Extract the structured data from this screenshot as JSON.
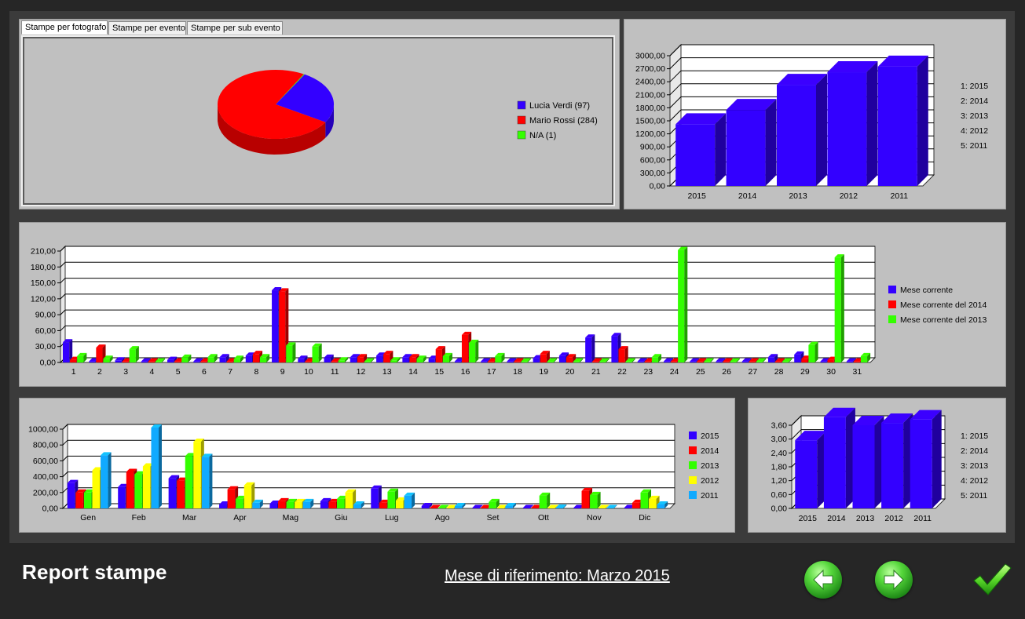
{
  "tabs": [
    "Stampe per fotografo",
    "Stampe per evento",
    "Stampe per sub evento"
  ],
  "footer": {
    "title": "Report stampe",
    "reference": "Mese di riferimento: Marzo 2015"
  },
  "icons": {
    "back": "arrow-left-icon",
    "forward": "arrow-right-icon",
    "confirm": "checkmark-icon"
  },
  "colors": {
    "2015": "#3300ff",
    "2014": "#ff0000",
    "2013": "#33ff00",
    "2012": "#ffff00",
    "2011": "#11aaff",
    "panel": "#c0c0c0"
  },
  "chart_data": [
    {
      "type": "pie",
      "slices": [
        {
          "label": "Lucia Verdi (97)",
          "value": 97,
          "color": "#3300ff"
        },
        {
          "label": "Mario Rossi (284)",
          "value": 284,
          "color": "#ff0000"
        },
        {
          "label": "N/A (1)",
          "value": 1,
          "color": "#33ff00"
        }
      ]
    },
    {
      "type": "bar",
      "categories": [
        "2015",
        "2014",
        "2013",
        "2012",
        "2011"
      ],
      "values": [
        1420,
        1750,
        2330,
        2620,
        2750
      ],
      "ylim": [
        0,
        3000
      ],
      "yticks": [
        "0,00",
        "300,00",
        "600,00",
        "900,00",
        "1200,00",
        "1500,00",
        "1800,00",
        "2100,00",
        "2400,00",
        "2700,00",
        "3000,00"
      ],
      "legend": [
        "1: 2015",
        "2: 2014",
        "3: 2013",
        "4: 2012",
        "5: 2011"
      ]
    },
    {
      "type": "bar",
      "categories": [
        "1",
        "2",
        "3",
        "4",
        "5",
        "6",
        "7",
        "8",
        "9",
        "10",
        "11",
        "12",
        "13",
        "14",
        "15",
        "16",
        "17",
        "18",
        "19",
        "20",
        "21",
        "22",
        "23",
        "24",
        "25",
        "26",
        "27",
        "28",
        "29",
        "30",
        "31"
      ],
      "ylim": [
        0,
        210
      ],
      "yticks": [
        "0,00",
        "30,00",
        "60,00",
        "90,00",
        "120,00",
        "150,00",
        "180,00",
        "210,00"
      ],
      "series": [
        {
          "name": "Mese corrente",
          "color": "#3300ff",
          "values": [
            38,
            2,
            4,
            2,
            5,
            2,
            10,
            13,
            136,
            7,
            9,
            10,
            13,
            10,
            7,
            2,
            2,
            2,
            8,
            13,
            47,
            50,
            2,
            2,
            2,
            2,
            2,
            10,
            15,
            2,
            2
          ]
        },
        {
          "name": "Mese corrente del 2014",
          "color": "#ff0000",
          "values": [
            5,
            28,
            2,
            2,
            2,
            2,
            2,
            16,
            134,
            2,
            2,
            10,
            16,
            10,
            25,
            52,
            2,
            2,
            16,
            10,
            2,
            25,
            2,
            2,
            2,
            2,
            2,
            2,
            7,
            5,
            2
          ]
        },
        {
          "name": "Mese corrente del 2013",
          "color": "#33ff00",
          "values": [
            12,
            7,
            25,
            2,
            9,
            10,
            7,
            10,
            32,
            30,
            4,
            2,
            4,
            7,
            12,
            37,
            12,
            2,
            2,
            2,
            2,
            2,
            10,
            212,
            2,
            2,
            2,
            2,
            33,
            198,
            12
          ]
        }
      ]
    },
    {
      "type": "bar",
      "categories": [
        "Gen",
        "Feb",
        "Mar",
        "Apr",
        "Mag",
        "Giu",
        "Lug",
        "Ago",
        "Set",
        "Ott",
        "Nov",
        "Dic"
      ],
      "ylim": [
        0,
        1000
      ],
      "yticks": [
        "0,00",
        "200,00",
        "400,00",
        "600,00",
        "800,00",
        "1000,00"
      ],
      "series": [
        {
          "name": "2015",
          "color": "#3300ff",
          "values": [
            320,
            270,
            380,
            50,
            60,
            90,
            250,
            30,
            5,
            5,
            5,
            5
          ]
        },
        {
          "name": "2014",
          "color": "#ff0000",
          "values": [
            200,
            460,
            350,
            240,
            90,
            80,
            70,
            5,
            5,
            5,
            220,
            70
          ]
        },
        {
          "name": "2013",
          "color": "#33ff00",
          "values": [
            200,
            430,
            660,
            120,
            80,
            120,
            210,
            5,
            80,
            160,
            170,
            200
          ]
        },
        {
          "name": "2012",
          "color": "#ffff00",
          "values": [
            480,
            530,
            840,
            290,
            80,
            200,
            100,
            5,
            5,
            5,
            5,
            120
          ]
        },
        {
          "name": "2011",
          "color": "#11aaff",
          "values": [
            670,
            1020,
            650,
            70,
            80,
            50,
            160,
            30,
            30,
            10,
            5,
            50
          ]
        }
      ]
    },
    {
      "type": "bar",
      "categories": [
        "2015",
        "2014",
        "2013",
        "2012",
        "2011"
      ],
      "values": [
        2.95,
        3.95,
        3.6,
        3.7,
        3.85
      ],
      "ylim": [
        0,
        3.6
      ],
      "yticks": [
        "0,00",
        "0,60",
        "1,20",
        "1,80",
        "2,40",
        "3,00",
        "3,60"
      ],
      "legend": [
        "1: 2015",
        "2: 2014",
        "3: 2013",
        "4: 2012",
        "5: 2011"
      ]
    }
  ]
}
